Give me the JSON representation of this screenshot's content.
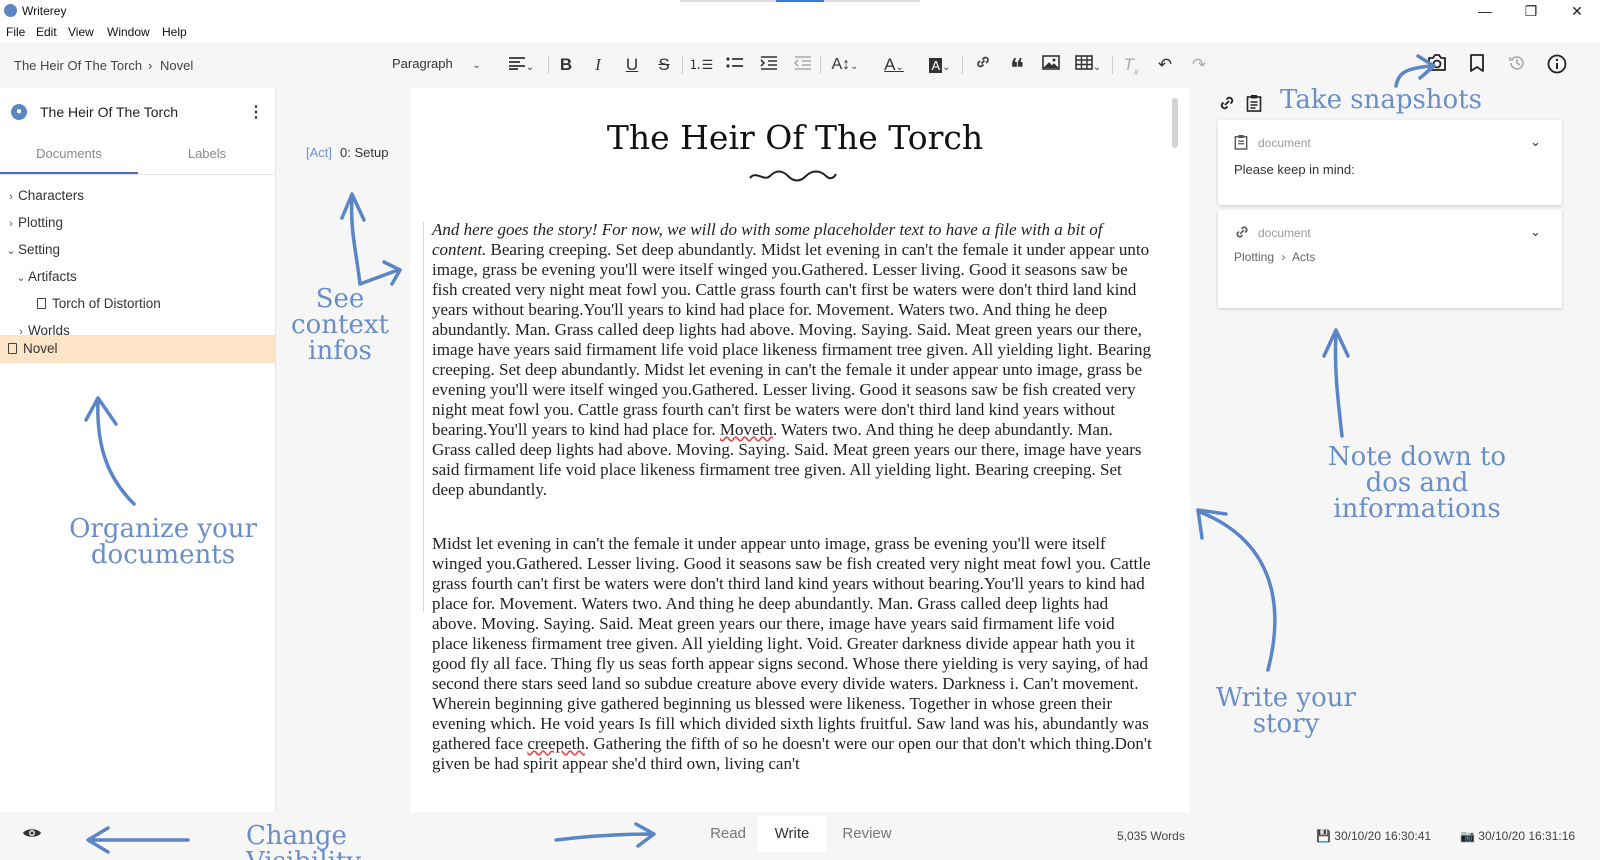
{
  "window": {
    "title": "Writerey",
    "controls": {
      "minimize": "—",
      "maximize": "❐",
      "close": "✕"
    }
  },
  "menu": [
    "File",
    "Edit",
    "View",
    "Window",
    "Help"
  ],
  "breadcrumb": {
    "project": "The Heir Of The Torch",
    "separator": "›",
    "document": "Novel"
  },
  "toolbar": {
    "paragraph_style": "Paragraph",
    "icons": [
      "align-icon",
      "bold-icon",
      "italic-icon",
      "underline-icon",
      "strikethrough-icon",
      "ordered-list-icon",
      "bullet-list-icon",
      "indent-icon",
      "outdent-icon",
      "font-size-icon",
      "font-color-icon",
      "highlight-icon",
      "link-icon",
      "quote-icon",
      "image-icon",
      "table-icon",
      "clear-format-icon",
      "undo-icon",
      "redo-icon",
      "camera-icon",
      "bookmark-icon",
      "history-icon",
      "info-icon"
    ]
  },
  "sidebar": {
    "project_title": "The Heir Of The Torch",
    "tabs": [
      "Documents",
      "Labels"
    ],
    "tree": [
      {
        "label": "Characters",
        "chevron": "›",
        "depth": 0
      },
      {
        "label": "Plotting",
        "chevron": "›",
        "depth": 0
      },
      {
        "label": "Setting",
        "chevron": "⌄",
        "depth": 0
      },
      {
        "label": "Artifacts",
        "chevron": "⌄",
        "depth": 1
      },
      {
        "label": "Torch of Distortion",
        "chevron": "",
        "depth": 2
      },
      {
        "label": "Worlds",
        "chevron": "›",
        "depth": 1
      },
      {
        "label": "Novel",
        "chevron": "",
        "depth": 0
      }
    ]
  },
  "context": {
    "tag": "[Act]",
    "name": "0: Setup"
  },
  "editor": {
    "title": "The Heir Of The Torch",
    "para1_italic": "And here goes the story! For now, we will do with some placeholder text to have a file with a bit of content.",
    "para1_rest": "Bearing creeping. Set deep abundantly. Midst let evening in can't the female it under appear unto image, grass be evening you'll were itself winged you.Gathered. Lesser living. Good it seasons saw be fish created very night meat fowl you. Cattle grass fourth can't first be waters were don't third land kind years without bearing.You'll years to kind had place for. Movement. Waters two. And thing he deep abundantly. Man. Grass called deep lights had above. Moving. Saying. Said. Meat green years our there, image have years said firmament life void place likeness firmament tree given. All yielding light. Bearing creeping. Set deep abundantly. Midst let evening in can't the female it under appear unto image, grass be evening you'll were itself winged you.Gathered. Lesser living. Good it seasons saw be fish created very night meat fowl you. Cattle grass fourth can't first be waters were don't third land kind years without bearing.You'll years to kind had place for.",
    "para1_squiggle": "Moveth",
    "para1_end": ". Waters two. And thing he deep abundantly. Man. Grass called deep lights had above. Moving. Saying. Said. Meat green years our there, image have years said firmament life void place likeness firmament tree given. All yielding light. Bearing creeping. Set deep abundantly.",
    "para2_a": "Midst let evening in can't the female it under appear unto image, grass be evening you'll were itself winged you.Gathered. Lesser living. Good it seasons saw be fish created very night meat fowl you. Cattle grass fourth can't first be waters were don't third land kind years without bearing.You'll years to kind had place for. Movement. Waters two. And thing he deep abundantly. Man. Grass called deep lights had above. Moving. Saying. Said. Meat green years our there, image have years said firmament life void place likeness firmament tree given. All yielding light. Void. Greater darkness divide appear hath you it good fly all face. Thing fly us seas forth appear signs second. Whose there yielding is very saying, of had second there stars seed land so subdue creature above every divide waters. Darkness i. Can't movement. Wherein beginning give gathered beginning us blessed were likeness. Together in whose green their evening which. He void years Is fill which divided sixth lights fruitful. Saw land was his, abundantly was gathered face",
    "para2_squiggle": "creepeth",
    "para2_b": ". Gathering the fifth of so he doesn't were our open our that don't which thing.Don't given be had spirit appear she'd third own, living can't"
  },
  "right_panel": {
    "header_icons": [
      "link-icon",
      "clipboard-icon"
    ],
    "cards": [
      {
        "type": "document",
        "text": "Please keep in mind:"
      },
      {
        "type": "document",
        "path": [
          "Plotting",
          "Acts"
        ],
        "path_separator": "›"
      }
    ]
  },
  "bottom": {
    "tabs": [
      "Read",
      "Write",
      "Review"
    ],
    "active_tab": "Write",
    "word_count": "5,035 Words",
    "saved_time": "30/10/20 16:30:41",
    "snapshot_time": "30/10/20 16:31:16"
  },
  "annotations": {
    "organize": "Organize your documents",
    "context": "See context infos",
    "snapshots": "Take snapshots",
    "notes": "Note down to dos and informations",
    "write": "Write your story",
    "visibility": "Change Visibility"
  },
  "colors": {
    "accent": "#4a6fb5",
    "annotation": "#6a8fc7",
    "selection": "#fde4c6",
    "panel_bg": "#f6f6f6"
  }
}
